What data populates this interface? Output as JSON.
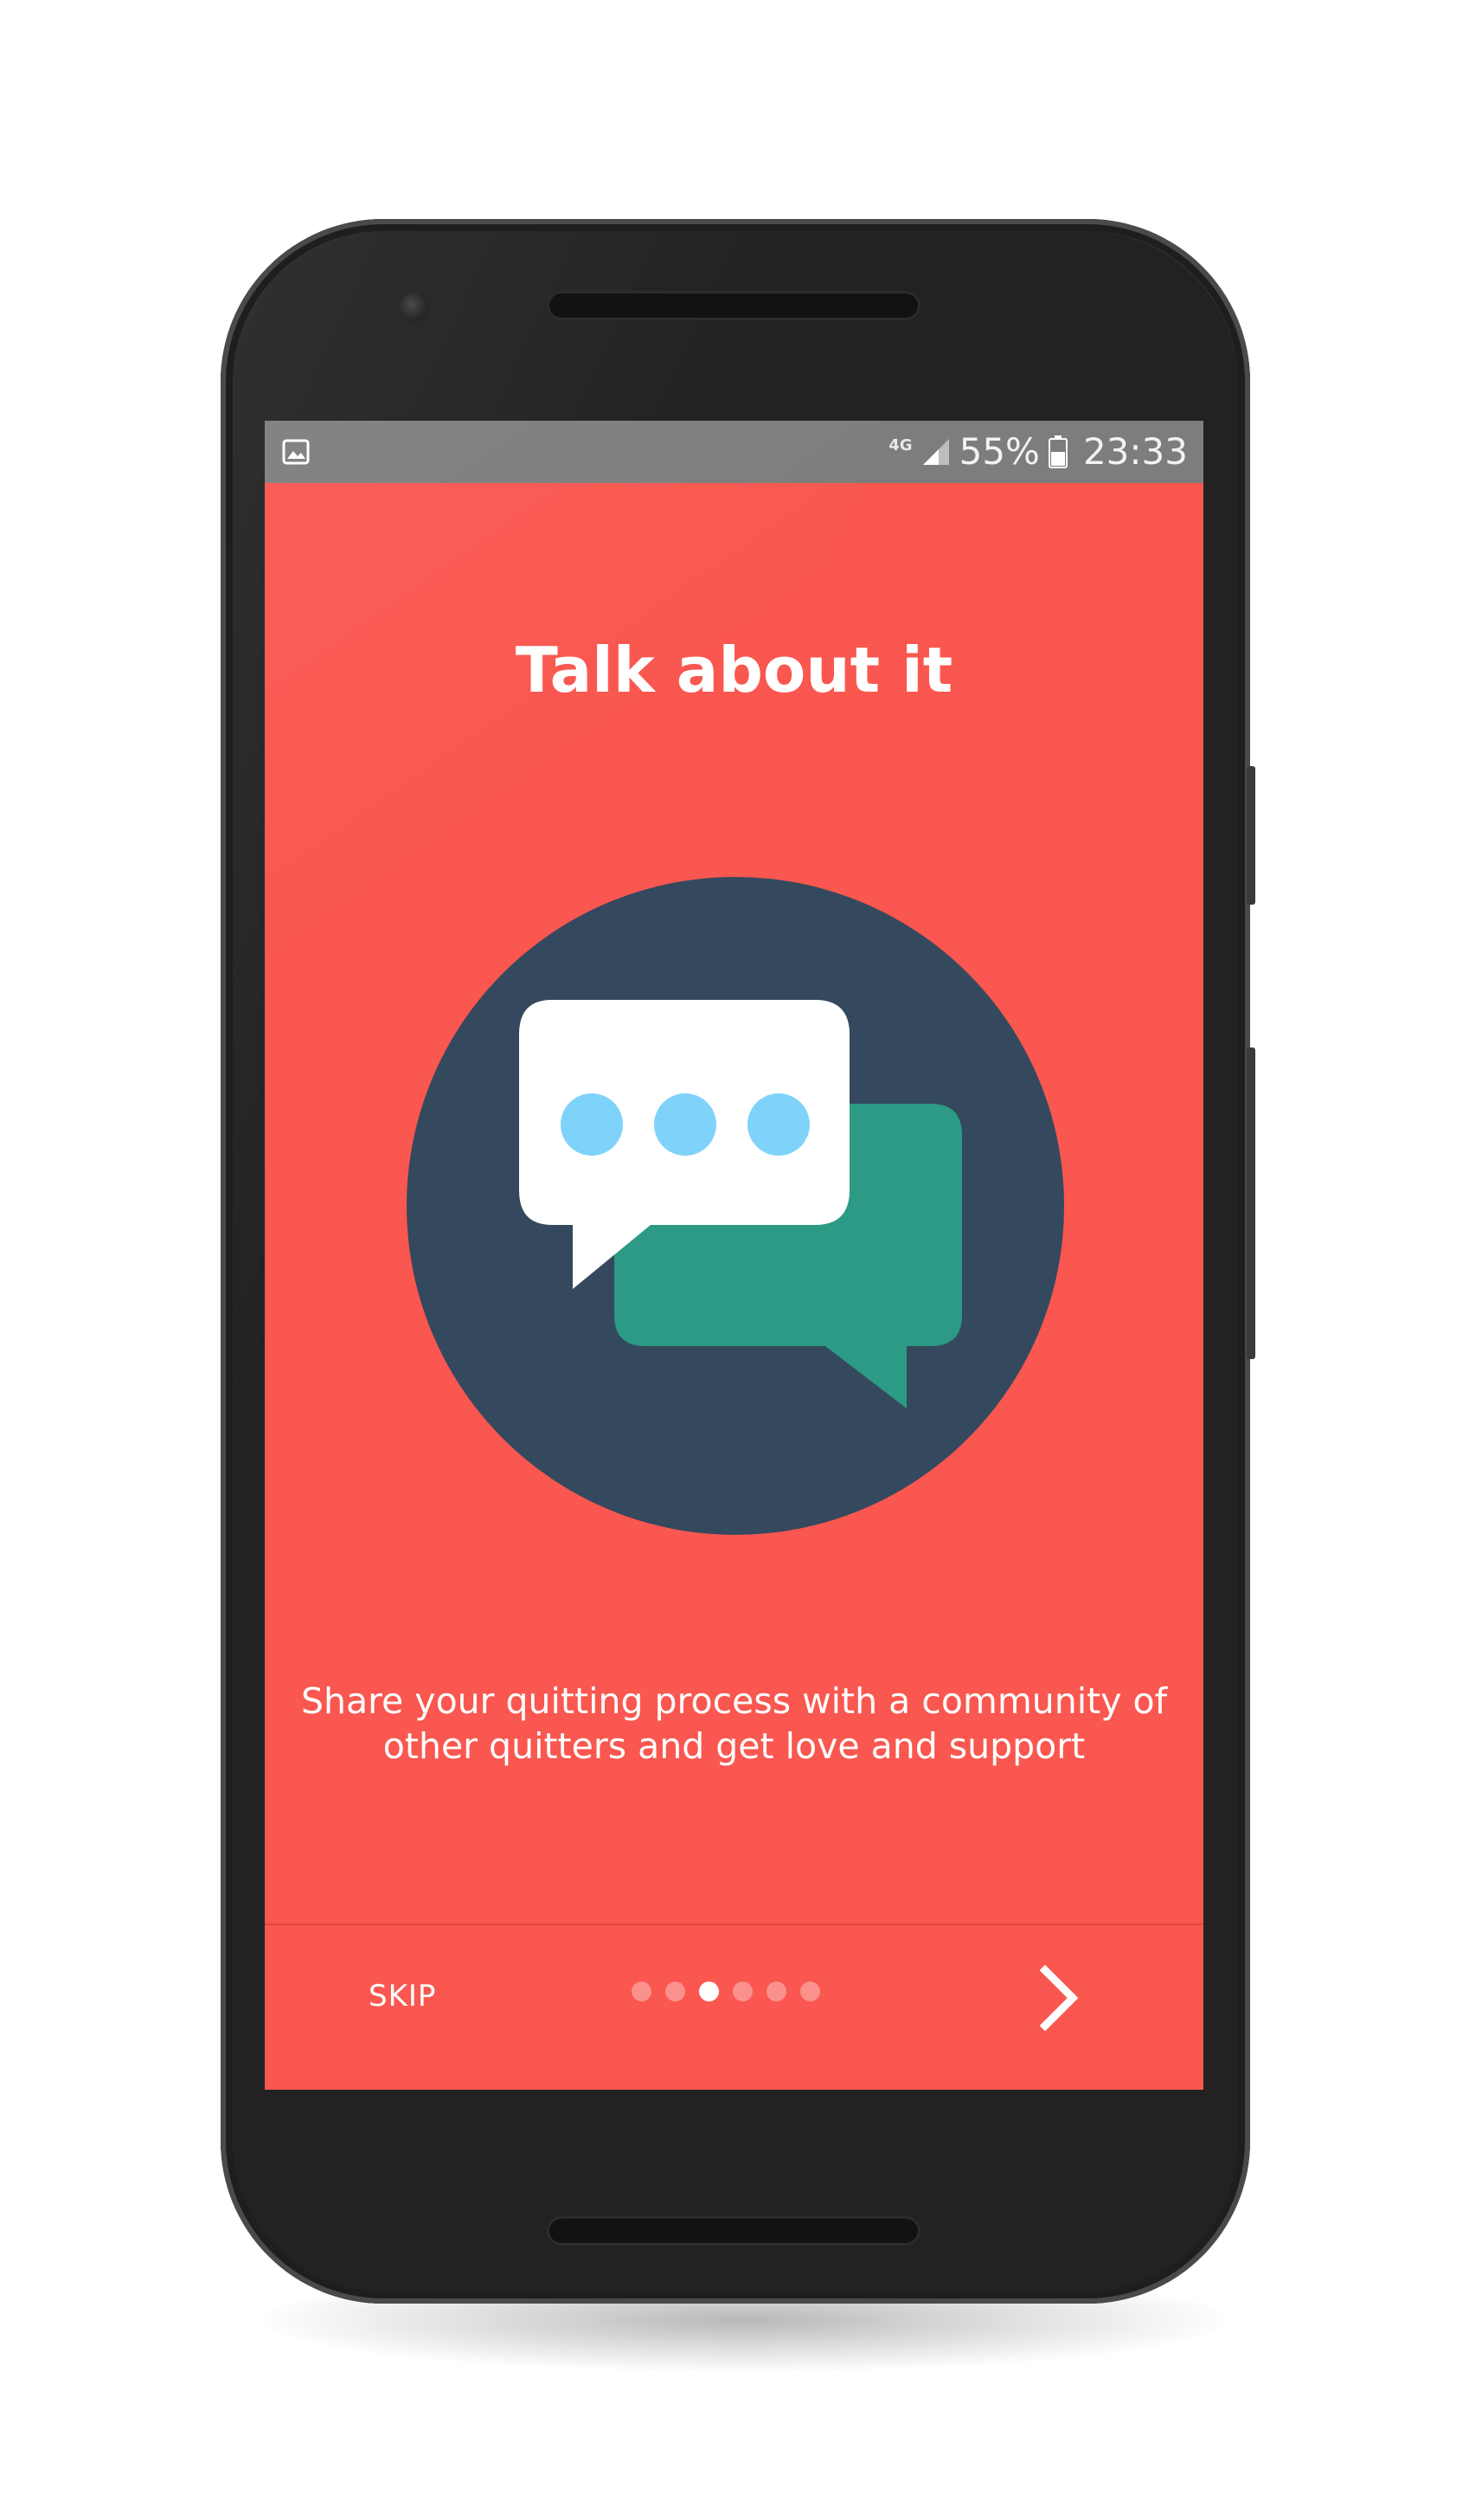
{
  "status_bar": {
    "network": "4G",
    "battery": "55%",
    "time": "23:33",
    "left_icon": "image-notification-icon",
    "signal_icon": "signal-icon",
    "battery_icon": "battery-icon"
  },
  "onboarding": {
    "title": "Talk about it",
    "description_line1": "Share your quitting process with a community of",
    "description_line2": "other quitters and get love and support",
    "illustration": "chat-bubbles-icon",
    "skip_label": "SKIP",
    "next_icon": "chevron-right-icon",
    "page_count": 6,
    "current_page": 3
  },
  "colors": {
    "screen_background": "#f9574f",
    "circle": "#34495e",
    "bubble_front": "#ffffff",
    "bubble_back": "#2c9a84",
    "bubble_dots": "#7fd3fb",
    "status_bar": "#7d7d7d"
  }
}
